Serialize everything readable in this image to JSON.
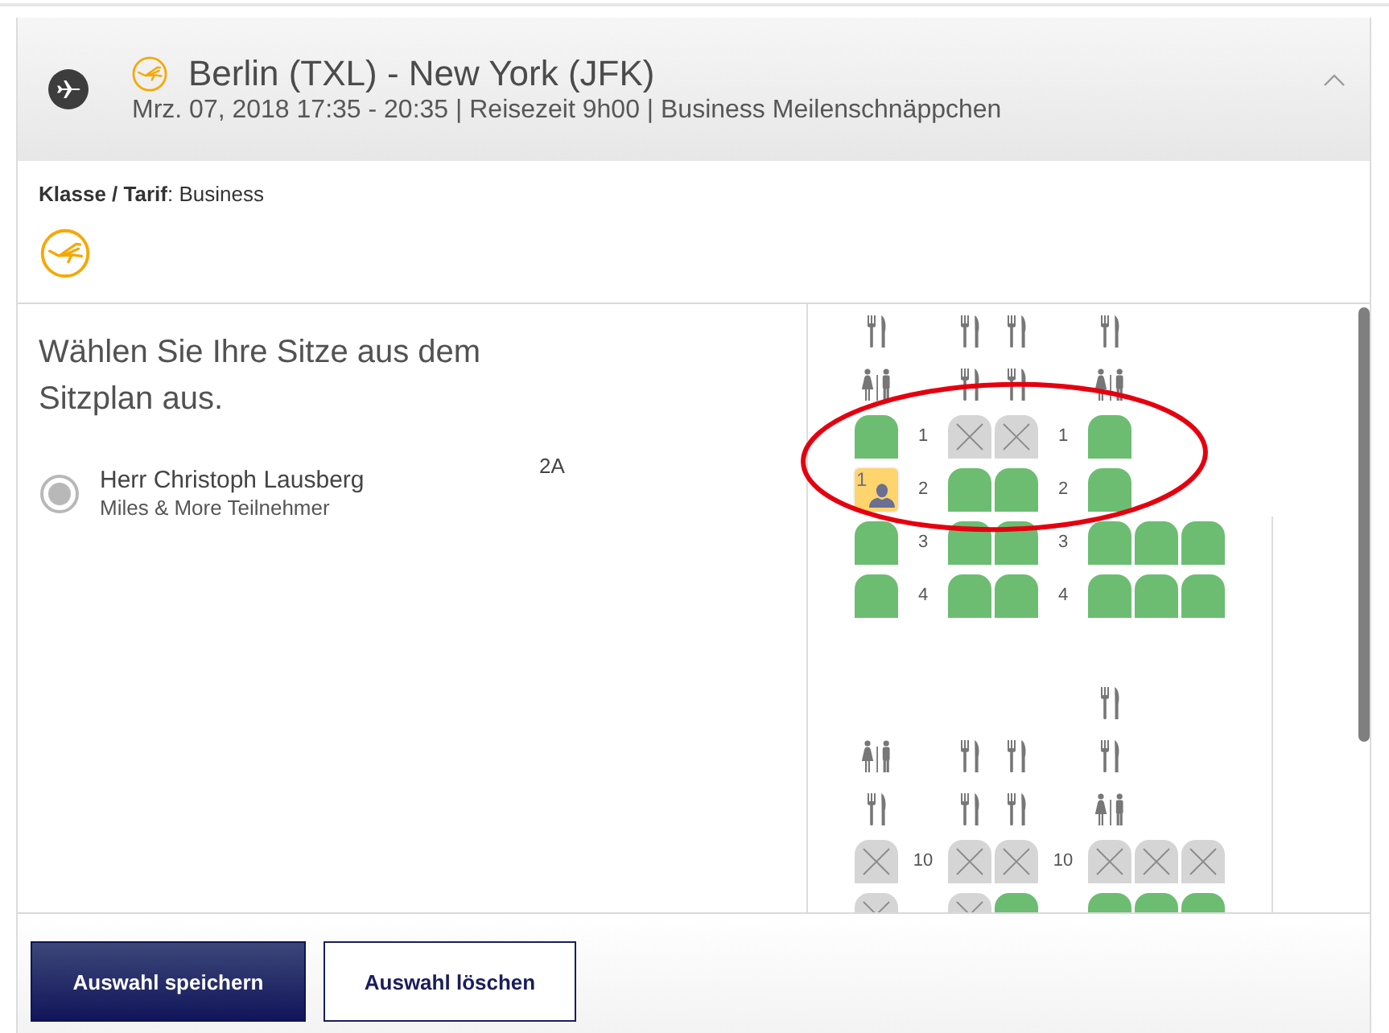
{
  "flight": {
    "title": "Berlin (TXL) - New York (JFK)",
    "details": "Mrz. 07, 2018 17:35 - 20:35 | Reisezeit 9h00 | Business Meilenschnäppchen",
    "expanded": true
  },
  "fare": {
    "text": "**Klasse / Tarif**: Business"
  },
  "instructions": "Wählen Sie Ihre Sitze aus dem Sitzplan aus.",
  "passengers": [
    {
      "name": "Herr Christoph Lausberg",
      "program": "Miles & More Teilnehmer",
      "seat": "2A",
      "selected": true
    }
  ],
  "seat_map": {
    "rows": [
      {
        "kind": "facilities",
        "items": [
          {
            "kind": "galley"
          },
          {
            "kind": "galley"
          },
          {
            "kind": "galley"
          },
          {
            "kind": "galley"
          },
          {
            "kind": "none"
          },
          {
            "kind": "none"
          }
        ]
      },
      {
        "kind": "facilities",
        "items": [
          {
            "kind": "lavatory"
          },
          {
            "kind": "galley"
          },
          {
            "kind": "galley"
          },
          {
            "kind": "lavatory"
          },
          {
            "kind": "none"
          },
          {
            "kind": "none"
          }
        ]
      },
      {
        "kind": "seats",
        "numbers": [
          "1",
          "1"
        ],
        "seats": [
          {
            "kind": "seat",
            "occupied": false,
            "selected": false
          },
          {
            "kind": "seat",
            "occupied": true,
            "selected": false
          },
          {
            "kind": "seat",
            "occupied": true,
            "selected": false
          },
          {
            "kind": "seat",
            "occupied": false,
            "selected": false
          },
          {
            "kind": "none"
          },
          {
            "kind": "none"
          }
        ]
      },
      {
        "kind": "seats",
        "numbers": [
          "2",
          "2"
        ],
        "seats": [
          {
            "kind": "seat",
            "occupied": false,
            "selected": true,
            "label": "1"
          },
          {
            "kind": "seat",
            "occupied": false,
            "selected": false
          },
          {
            "kind": "seat",
            "occupied": false,
            "selected": false
          },
          {
            "kind": "seat",
            "occupied": false,
            "selected": false
          },
          {
            "kind": "none"
          },
          {
            "kind": "none"
          }
        ]
      },
      {
        "kind": "seats",
        "numbers": [
          "3",
          "3"
        ],
        "seats": [
          {
            "kind": "seat",
            "occupied": false,
            "selected": false
          },
          {
            "kind": "seat",
            "occupied": false,
            "selected": false
          },
          {
            "kind": "seat",
            "occupied": false,
            "selected": false
          },
          {
            "kind": "seat",
            "occupied": false,
            "selected": false
          },
          {
            "kind": "seat",
            "occupied": false,
            "selected": false
          },
          {
            "kind": "seat",
            "occupied": false,
            "selected": false
          }
        ]
      },
      {
        "kind": "seats",
        "numbers": [
          "4",
          "4"
        ],
        "seats": [
          {
            "kind": "seat",
            "occupied": false,
            "selected": false
          },
          {
            "kind": "seat",
            "occupied": false,
            "selected": false
          },
          {
            "kind": "seat",
            "occupied": false,
            "selected": false
          },
          {
            "kind": "seat",
            "occupied": false,
            "selected": false
          },
          {
            "kind": "seat",
            "occupied": false,
            "selected": false
          },
          {
            "kind": "seat",
            "occupied": false,
            "selected": false
          }
        ]
      },
      {
        "kind": "gap"
      },
      {
        "kind": "facilities",
        "items": [
          {
            "kind": "none"
          },
          {
            "kind": "none"
          },
          {
            "kind": "none"
          },
          {
            "kind": "galley"
          },
          {
            "kind": "none"
          },
          {
            "kind": "none"
          }
        ]
      },
      {
        "kind": "facilities",
        "items": [
          {
            "kind": "lavatory"
          },
          {
            "kind": "galley"
          },
          {
            "kind": "galley"
          },
          {
            "kind": "galley"
          },
          {
            "kind": "none"
          },
          {
            "kind": "none"
          }
        ]
      },
      {
        "kind": "facilities",
        "items": [
          {
            "kind": "galley"
          },
          {
            "kind": "galley"
          },
          {
            "kind": "galley"
          },
          {
            "kind": "lavatory"
          },
          {
            "kind": "none"
          },
          {
            "kind": "none"
          }
        ]
      },
      {
        "kind": "seats",
        "numbers": [
          "10",
          "10"
        ],
        "seats": [
          {
            "kind": "seat",
            "occupied": true,
            "selected": false
          },
          {
            "kind": "seat",
            "occupied": true,
            "selected": false
          },
          {
            "kind": "seat",
            "occupied": true,
            "selected": false
          },
          {
            "kind": "seat",
            "occupied": true,
            "selected": false
          },
          {
            "kind": "seat",
            "occupied": true,
            "selected": false
          },
          {
            "kind": "seat",
            "occupied": true,
            "selected": false
          }
        ]
      },
      {
        "kind": "seats",
        "seats": [
          {
            "kind": "seat",
            "occupied": true,
            "selected": false
          },
          {
            "kind": "seat",
            "occupied": true,
            "selected": false
          },
          {
            "kind": "seat",
            "occupied": false,
            "selected": false
          },
          {
            "kind": "seat",
            "occupied": false,
            "selected": false
          },
          {
            "kind": "seat",
            "occupied": false,
            "selected": false
          },
          {
            "kind": "seat",
            "occupied": false,
            "selected": false
          }
        ]
      }
    ]
  },
  "buttons": [
    {
      "label": "Auswahl speichern",
      "kind": "primary"
    },
    {
      "label": "Auswahl löschen",
      "kind": "secondary"
    }
  ],
  "annotations": [
    {
      "kind": "ellipse"
    }
  ]
}
